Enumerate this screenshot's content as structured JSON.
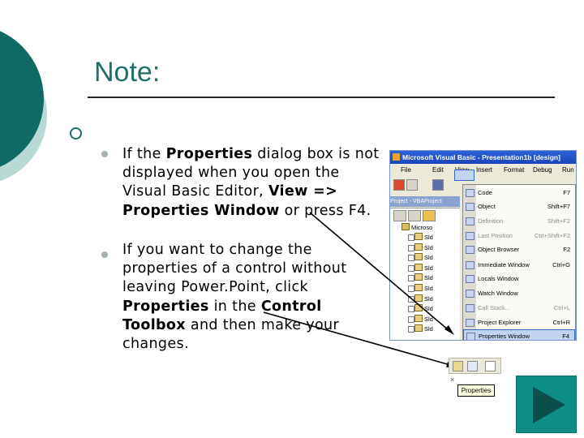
{
  "slide": {
    "title": "Note:",
    "bullets": [
      {
        "parts": [
          {
            "t": "If the ",
            "b": false
          },
          {
            "t": "Properties",
            "b": true
          },
          {
            "t": " dialog box is not displayed when you open the Visual Basic Editor, ",
            "b": false
          },
          {
            "t": "View => Properties Window",
            "b": true
          },
          {
            "t": " or press F4.",
            "b": false
          }
        ]
      },
      {
        "parts": [
          {
            "t": "If you want to change the properties of a control without leaving Power.Point, click ",
            "b": false
          },
          {
            "t": "Properties",
            "b": true
          },
          {
            "t": " in the ",
            "b": false
          },
          {
            "t": "Control Toolbox",
            "b": true
          },
          {
            "t": " and then make your changes.",
            "b": false
          }
        ]
      }
    ]
  },
  "vb_editor": {
    "window_title": "Microsoft Visual Basic - Presentation1b [design]",
    "menus": [
      "File",
      "Edit",
      "View",
      "Insert",
      "Format",
      "Debug",
      "Run"
    ],
    "project_pane_title": "Project - VBAProject",
    "tree_root": "Microso",
    "tree_items": [
      "Sld",
      "Sld",
      "Sld",
      "Sld",
      "Sld",
      "Sld",
      "Sld",
      "Sld",
      "Sld",
      "Sld"
    ],
    "view_menu": [
      {
        "label": "Code",
        "shortcut": "F7",
        "enabled": true
      },
      {
        "label": "Object",
        "shortcut": "Shift+F7",
        "enabled": true
      },
      {
        "label": "Definition",
        "shortcut": "Shift+F2",
        "enabled": false
      },
      {
        "label": "Last Position",
        "shortcut": "Ctrl+Shift+F2",
        "enabled": false
      },
      {
        "label": "Object Browser",
        "shortcut": "F2",
        "enabled": true
      },
      {
        "label": "Immediate Window",
        "shortcut": "Ctrl+G",
        "enabled": true
      },
      {
        "label": "Locals Window",
        "shortcut": "",
        "enabled": true
      },
      {
        "label": "Watch Window",
        "shortcut": "",
        "enabled": true
      },
      {
        "label": "Call Stack...",
        "shortcut": "Ctrl+L",
        "enabled": false
      },
      {
        "label": "Project Explorer",
        "shortcut": "Ctrl+R",
        "enabled": true
      },
      {
        "label": "Properties Window",
        "shortcut": "F4",
        "enabled": true,
        "selected": true
      }
    ]
  },
  "control_toolbox": {
    "close_glyph": "×",
    "tooltip": "Properties"
  },
  "colors": {
    "accent": "#1f6e6a",
    "next_button": "#0e8e84",
    "menu_highlight": "#c2d3f0"
  },
  "icons": {
    "next_button": "play-triangle-icon",
    "bullet_ring": "hollow-circle-icon"
  }
}
